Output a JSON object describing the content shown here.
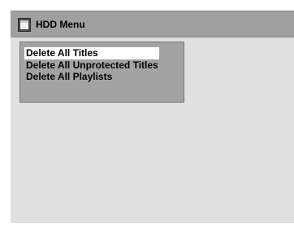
{
  "header": {
    "title": "HDD Menu",
    "icon": "hdd-icon"
  },
  "menu": {
    "items": [
      {
        "label": "Delete All Titles",
        "selected": true
      },
      {
        "label": "Delete All Unprotected Titles",
        "selected": false
      },
      {
        "label": "Delete All Playlists",
        "selected": false
      }
    ]
  },
  "colors": {
    "titlebar": "#a0a0a0",
    "background": "#e0e0e0",
    "menu_box": "#a3a3a3",
    "selection": "#ffffff"
  }
}
